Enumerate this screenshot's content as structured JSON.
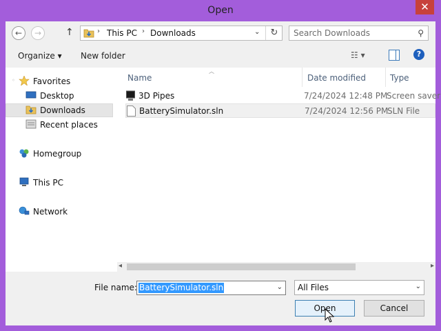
{
  "window": {
    "title": "Open",
    "close_glyph": "✕"
  },
  "nav": {
    "back_glyph": "←",
    "forward_glyph": "→",
    "up_glyph": "↑",
    "breadcrumbs": [
      "This PC",
      "Downloads"
    ],
    "crumb_sep": "›",
    "dropdown_glyph": "⌄",
    "refresh_glyph": "↻",
    "search_placeholder": "Search Downloads",
    "search_glyph": "⚲"
  },
  "toolbar": {
    "organize_label": "Organize ▾",
    "new_folder_label": "New folder",
    "view_glyph": "☷ ▾",
    "help_glyph": "?"
  },
  "sidebar": {
    "favorites": "Favorites",
    "items": [
      {
        "label": "Desktop"
      },
      {
        "label": "Downloads",
        "selected": true
      },
      {
        "label": "Recent places"
      }
    ],
    "homegroup": "Homegroup",
    "this_pc": "This PC",
    "network": "Network"
  },
  "columns": {
    "name": "Name",
    "date": "Date modified",
    "type": "Type"
  },
  "files": [
    {
      "name": "3D Pipes",
      "date": "7/24/2024 12:48 PM",
      "type": "Screen saver",
      "icon": "screensaver-icon"
    },
    {
      "name": "BatterySimulator.sln",
      "date": "7/24/2024 12:56 PM",
      "type": "SLN File",
      "icon": "document-icon"
    }
  ],
  "scroll": {
    "left_glyph": "◂",
    "right_glyph": "▸"
  },
  "bottom": {
    "filename_label": "File name:",
    "filename_value": "BatterySimulator.sln",
    "filter_value": "All Files",
    "dropdown_glyph": "⌄",
    "open_label": "Open",
    "cancel_label": "Cancel"
  },
  "colors": {
    "frame": "#a35ddb",
    "accent": "#3399ff",
    "close": "#c7413c"
  }
}
